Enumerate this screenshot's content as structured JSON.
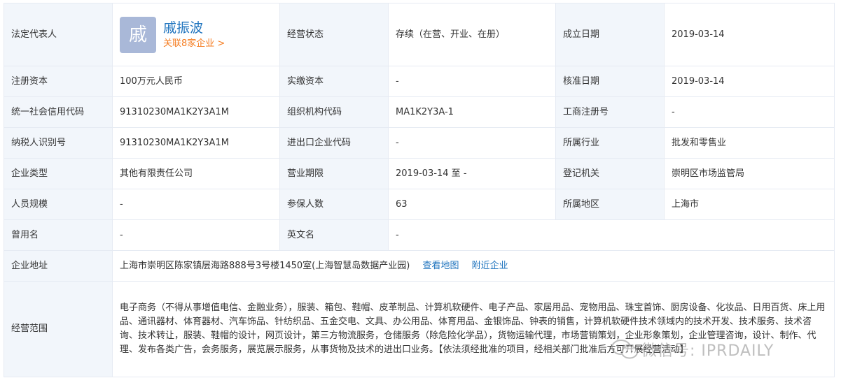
{
  "legal_rep": {
    "label": "法定代表人",
    "avatar_char": "戚",
    "name": "戚振波",
    "related": "关联8家企业 >"
  },
  "rows": [
    [
      {
        "label": "经营状态",
        "value": "存续（在营、开业、在册）"
      },
      {
        "label": "成立日期",
        "value": "2019-03-14"
      }
    ],
    [
      {
        "label": "注册资本",
        "value": "100万元人民币"
      },
      {
        "label": "实缴资本",
        "value": "-"
      },
      {
        "label": "核准日期",
        "value": "2019-03-14"
      }
    ],
    [
      {
        "label": "统一社会信用代码",
        "value": "91310230MA1K2Y3A1M"
      },
      {
        "label": "组织机构代码",
        "value": "MA1K2Y3A-1"
      },
      {
        "label": "工商注册号",
        "value": "-"
      }
    ],
    [
      {
        "label": "纳税人识别号",
        "value": "91310230MA1K2Y3A1M"
      },
      {
        "label": "进出口企业代码",
        "value": "-"
      },
      {
        "label": "所属行业",
        "value": "批发和零售业"
      }
    ],
    [
      {
        "label": "企业类型",
        "value": "其他有限责任公司"
      },
      {
        "label": "营业期限",
        "value": "2019-03-14 至 -"
      },
      {
        "label": "登记机关",
        "value": "崇明区市场监管局"
      }
    ],
    [
      {
        "label": "人员规模",
        "value": "-"
      },
      {
        "label": "参保人数",
        "value": "63"
      },
      {
        "label": "所属地区",
        "value": "上海市"
      }
    ],
    [
      {
        "label": "曾用名",
        "value": "-"
      },
      {
        "label": "英文名",
        "value": "-"
      }
    ]
  ],
  "address": {
    "label": "企业地址",
    "value": "上海市崇明区陈家镇层海路888号3号楼1450室(上海智慧岛数据产业园)",
    "map_link": "查看地图",
    "nearby_link": "附近企业"
  },
  "scope": {
    "label": "经营范围",
    "value": "电子商务（不得从事增值电信、金融业务），服装、箱包、鞋帽、皮革制品、计算机软硬件、电子产品、家居用品、宠物用品、珠宝首饰、厨房设备、化妆品、日用百货、床上用品、通讯器材、体育器材、汽车饰品、针纺织品、五金交电、文具、办公用品、体育用品、金银饰品、钟表的销售，计算机软硬件技术领域内的技术开发、技术服务、技术咨询、技术转让，服装、鞋帽的设计，网页设计，第三方物流服务，仓储服务（除危险化学品），货物运输代理，市场营销策划，企业形象策划，企业管理咨询，设计、制作、代理、发布各类广告，会务服务，展览展示服务，从事货物及技术的进出口业务。【依法须经批准的项目，经相关部门批准后方可开展经营活动】"
  },
  "watermark": {
    "text": "微信号: IPRDAILY",
    "icon": "wechat-icon"
  },
  "colors": {
    "label_bg": "#f2f6fb",
    "border": "#e6ebf3",
    "link": "#1e73be",
    "accent": "#f57c20",
    "avatar_bg": "#a9b8d8"
  }
}
